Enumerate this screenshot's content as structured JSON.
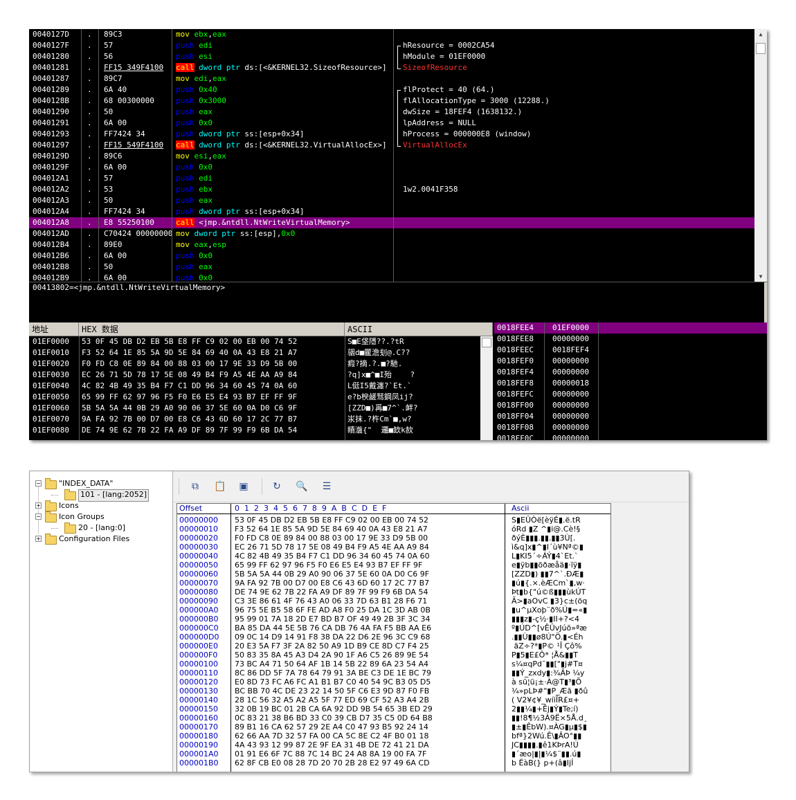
{
  "disasm": {
    "rows": [
      {
        "addr": "0040127D",
        "mark": ".",
        "hex": "89C3",
        "parts": [
          [
            "kw-mov",
            "mov "
          ],
          [
            "grn",
            "ebx"
          ],
          [
            "op",
            ","
          ],
          [
            "grn",
            "eax"
          ]
        ]
      },
      {
        "addr": "0040127F",
        "mark": ".",
        "hex": "57",
        "parts": [
          [
            "kw-push",
            "push "
          ],
          [
            "grn",
            "edi"
          ]
        ]
      },
      {
        "addr": "00401280",
        "mark": ".",
        "hex": "56",
        "parts": [
          [
            "kw-push",
            "push "
          ],
          [
            "grn",
            "esi"
          ]
        ]
      },
      {
        "addr": "00401281",
        "mark": ".",
        "hex": "FF15 349F4100",
        "hexul": true,
        "parts": [
          [
            "kw-call",
            "call"
          ],
          [
            "op",
            " "
          ],
          [
            "cyan",
            "dword ptr "
          ],
          [
            "op",
            "ds:[<&KERNEL32.SizeofResource>]"
          ]
        ]
      },
      {
        "addr": "00401287",
        "mark": ".",
        "hex": "89C7",
        "parts": [
          [
            "kw-mov",
            "mov "
          ],
          [
            "grn",
            "edi"
          ],
          [
            "op",
            ","
          ],
          [
            "grn",
            "eax"
          ]
        ]
      },
      {
        "addr": "00401289",
        "mark": ".",
        "hex": "6A 40",
        "parts": [
          [
            "kw-push",
            "push "
          ],
          [
            "grn",
            "0x40"
          ]
        ]
      },
      {
        "addr": "0040128B",
        "mark": ".",
        "hex": "68 00300000",
        "parts": [
          [
            "kw-push",
            "push "
          ],
          [
            "grn",
            "0x3000"
          ]
        ]
      },
      {
        "addr": "00401290",
        "mark": ".",
        "hex": "50",
        "parts": [
          [
            "kw-push",
            "push "
          ],
          [
            "grn",
            "eax"
          ]
        ]
      },
      {
        "addr": "00401291",
        "mark": ".",
        "hex": "6A 00",
        "parts": [
          [
            "kw-push",
            "push "
          ],
          [
            "grn",
            "0x0"
          ]
        ]
      },
      {
        "addr": "00401293",
        "mark": ".",
        "hex": "FF7424 34",
        "parts": [
          [
            "kw-push",
            "push "
          ],
          [
            "cyan",
            "dword ptr "
          ],
          [
            "op",
            "ss:[esp+0x34]"
          ]
        ]
      },
      {
        "addr": "00401297",
        "mark": ".",
        "hex": "FF15 549F4100",
        "hexul": true,
        "parts": [
          [
            "kw-call",
            "call"
          ],
          [
            "op",
            " "
          ],
          [
            "cyan",
            "dword ptr "
          ],
          [
            "op",
            "ds:[<&KERNEL32.VirtualAllocEx>]"
          ]
        ]
      },
      {
        "addr": "0040129D",
        "mark": ".",
        "hex": "89C6",
        "parts": [
          [
            "kw-mov",
            "mov "
          ],
          [
            "grn",
            "esi"
          ],
          [
            "op",
            ","
          ],
          [
            "grn",
            "eax"
          ]
        ]
      },
      {
        "addr": "0040129F",
        "mark": ".",
        "hex": "6A 00",
        "parts": [
          [
            "kw-push",
            "push "
          ],
          [
            "grn",
            "0x0"
          ]
        ]
      },
      {
        "addr": "004012A1",
        "mark": ".",
        "hex": "57",
        "parts": [
          [
            "kw-push",
            "push "
          ],
          [
            "grn",
            "edi"
          ]
        ]
      },
      {
        "addr": "004012A2",
        "mark": ".",
        "hex": "53",
        "parts": [
          [
            "kw-push",
            "push "
          ],
          [
            "grn",
            "ebx"
          ]
        ]
      },
      {
        "addr": "004012A3",
        "mark": ".",
        "hex": "50",
        "parts": [
          [
            "kw-push",
            "push "
          ],
          [
            "grn",
            "eax"
          ]
        ]
      },
      {
        "addr": "004012A4",
        "mark": ".",
        "hex": "FF7424 34",
        "parts": [
          [
            "kw-push",
            "push "
          ],
          [
            "cyan",
            "dword ptr "
          ],
          [
            "op",
            "ss:[esp+0x34]"
          ]
        ]
      },
      {
        "addr": "004012A8",
        "mark": ".",
        "hex": "E8 55250100",
        "sel": true,
        "parts": [
          [
            "kw-call",
            "call"
          ],
          [
            "op",
            " <jmp.&ntdll.NtWriteVirtualMemory>"
          ]
        ]
      },
      {
        "addr": "004012AD",
        "mark": ".",
        "hex": "C70424 00000000",
        "parts": [
          [
            "kw-mov",
            "mov "
          ],
          [
            "cyan",
            "dword ptr "
          ],
          [
            "op",
            "ss:[esp],"
          ],
          [
            "grn",
            "0x0"
          ]
        ]
      },
      {
        "addr": "004012B4",
        "mark": ".",
        "hex": "89E0",
        "parts": [
          [
            "kw-mov",
            "mov "
          ],
          [
            "grn",
            "eax"
          ],
          [
            "op",
            ","
          ],
          [
            "grn",
            "esp"
          ]
        ]
      },
      {
        "addr": "004012B6",
        "mark": ".",
        "hex": "6A 00",
        "parts": [
          [
            "kw-push",
            "push "
          ],
          [
            "grn",
            "0x0"
          ]
        ]
      },
      {
        "addr": "004012B8",
        "mark": ".",
        "hex": "50",
        "parts": [
          [
            "kw-push",
            "push "
          ],
          [
            "grn",
            "eax"
          ]
        ]
      },
      {
        "addr": "004012B9",
        "mark": ".",
        "hex": "6A 00",
        "parts": [
          [
            "kw-push",
            "push "
          ],
          [
            "grn",
            "0x0"
          ]
        ]
      }
    ],
    "comments": [
      {
        "row": 1,
        "text": "hResource = 0002CA54"
      },
      {
        "row": 2,
        "text": "hModule = 01EF0000"
      },
      {
        "row": 3,
        "text": "SizeofResource",
        "red": true
      },
      {
        "row": 5,
        "text": "flProtect = 40 (64.)"
      },
      {
        "row": 6,
        "text": "flAllocationType = 3000 (12288.)"
      },
      {
        "row": 7,
        "text": "dwSize = 18FEF4 (1638132.)"
      },
      {
        "row": 8,
        "text": "lpAddress = NULL"
      },
      {
        "row": 9,
        "text": "hProcess = 000000E8 (window)"
      },
      {
        "row": 10,
        "text": "VirtualAllocEx",
        "red": true
      },
      {
        "row": 14,
        "text": "1w2.0041F358"
      }
    ],
    "info": "00413802=<jmp.&ntdll.NtWriteVirtualMemory>"
  },
  "dump": {
    "headers": {
      "address": "地址",
      "hex": "HEX 数据",
      "ascii": "ASCII"
    },
    "rows": [
      {
        "addr": "01EF0000",
        "hex": "53 0F 45 DB D2 EB 5B E8 FF C9 02 00 EB 00 74 52",
        "ascii": "S■E垡隱??.?tR"
      },
      {
        "addr": "01EF0010",
        "hex": "F3 52 64 1E 85 5A 9D 5E 84 69 40 0A 43 E8 21 A7",
        "ascii": "骃d■匷澹刬@.C??"
      },
      {
        "addr": "01EF0020",
        "hex": "F0 FD C8 0E 89 84 00 88 03 00 17 9E 33 D9 5B 00",
        "ascii": "瘕?摘.?.■?馳."
      },
      {
        "addr": "01EF0030",
        "hex": "EC 26 71 5D 78 17 5E 08 49 B4 F9 A5 4E AA A9 84",
        "ascii": "?q]x■^■I殆    ?"
      },
      {
        "addr": "01EF0040",
        "hex": "4C 82 4B 49 35 B4 F7 C1 DD 96 34 60 45 74 0A 60",
        "ascii": "L侹I5戴瀍?`Et.`"
      },
      {
        "addr": "01EF0050",
        "hex": "65 99 FF 62 97 96 F5 F0 E6 E5 E4 93 B7 EF FF 9F",
        "ascii": "e?b楰鹾驽鋼凤ij?"
      },
      {
        "addr": "01EF0060",
        "hex": "5B 5A 5A 44 0B 29 A0 90 06 37 5E 60 0A D0 C6 9F",
        "ascii": "[ZZD■)爯■7^`.衅?"
      },
      {
        "addr": "01EF0070",
        "hex": "9A FA 92 7B 00 D7 00 E8 C6 43 6D 60 17 2C 77 B7",
        "ascii": "汖抹.?杵Cm`■,w?"
      },
      {
        "addr": "01EF0080",
        "hex": "DE 74 9E 62 7B 22 FA A9 DF 89 7F 99 F9 6B DA 54",
        "ascii": "瞔瀊{\"  邏■欫k赥"
      }
    ]
  },
  "stack": {
    "rows": [
      {
        "addr": "0018FEE4",
        "val": "01EF0000",
        "sel": true
      },
      {
        "addr": "0018FEE8",
        "val": "00000000"
      },
      {
        "addr": "0018FEEC",
        "val": "0018FEF4"
      },
      {
        "addr": "0018FEF0",
        "val": "00000000"
      },
      {
        "addr": "0018FEF4",
        "val": "00000000"
      },
      {
        "addr": "0018FEF8",
        "val": "00000018"
      },
      {
        "addr": "0018FEFC",
        "val": "00000000"
      },
      {
        "addr": "0018FF00",
        "val": "00000000"
      },
      {
        "addr": "0018FF04",
        "val": "00000000"
      },
      {
        "addr": "0018FF08",
        "val": "00000000"
      },
      {
        "addr": "0018FF0C",
        "val": "00000000"
      }
    ]
  },
  "tree": {
    "items": [
      {
        "label": "\"INDEX_DATA\"",
        "level": 0,
        "box": "−"
      },
      {
        "label": "101 - [lang:2052]",
        "level": 1,
        "selected": true
      },
      {
        "label": "Icons",
        "level": 0,
        "box": "+"
      },
      {
        "label": "Icon Groups",
        "level": 0,
        "box": "−"
      },
      {
        "label": "20 - [lang:0]",
        "level": 1
      },
      {
        "label": "Configuration Files",
        "level": 0,
        "box": "+"
      }
    ]
  },
  "toolbar": {
    "icons": [
      "copy-icon",
      "paste-icon",
      "window-icon",
      "redo-icon",
      "search-icon",
      "table-icon"
    ],
    "glyphs": [
      "⧉",
      "📋",
      "▣",
      "↻",
      "🔍",
      "☰"
    ]
  },
  "hexeditor": {
    "header": {
      "offset": "Offset",
      "cols": "0  1  2  3  4  5  6  7  8  9  A  B  C  D  E  F",
      "ascii": "Ascii"
    },
    "rows": [
      {
        "off": "00000000",
        "hex": "53 0F 45 DB D2 EB 5B E8 FF C9 02 00 EB 00 74 52",
        "asc": "S▮EÛÒë[èÿÉ▮.ë.tR"
      },
      {
        "off": "00000010",
        "hex": "F3 52 64 1E 85 5A 9D 5E 84 69 40 0A 43 E8 21 A7",
        "asc": "óRd ▮Z ^▮i@.Cè!§"
      },
      {
        "off": "00000020",
        "hex": "F0 FD C8 0E 89 84 00 88 03 00 17 9E 33 D9 5B 00",
        "asc": "ðýÈ▮▮▮.▮▮.▮▮3Ù[."
      },
      {
        "off": "00000030",
        "hex": "EC 26 71 5D 78 17 5E 08 49 B4 F9 A5 4E AA A9 84",
        "asc": "ì&q]x▮^▮I´ù¥Nª©▮"
      },
      {
        "off": "00000040",
        "hex": "4C 82 4B 49 35 B4 F7 C1 DD 96 34 60 45 74 0A 60",
        "asc": "L▮KI5´÷ÁÝ▮4`Et.`"
      },
      {
        "off": "00000050",
        "hex": "65 99 FF 62 97 96 F5 F0 E6 E5 E4 93 B7 EF FF 9F",
        "asc": "e▮ÿb▮▮õðæåä▮·ïÿ▮"
      },
      {
        "off": "00000060",
        "hex": "5B 5A 5A 44 0B 29 A0 90 06 37 5E 60 0A D0 C6 9F",
        "asc": "[ZZD▮) ▮▮7^`.ÐÆ▮"
      },
      {
        "off": "00000070",
        "hex": "9A FA 92 7B 00 D7 00 E8 C6 43 6D 60 17 2C 77 B7",
        "asc": "▮ú▮{.×.èÆCm`▮,w·"
      },
      {
        "off": "00000080",
        "hex": "DE 74 9E 62 7B 22 FA A9 DF 89 7F 99 F9 6B DA 54",
        "asc": "Þt▮b{\"ú©ß▮▮▮ùkÚT"
      },
      {
        "off": "00000090",
        "hex": "C3 3E 86 61 4F 76 43 A0 06 33 7D 63 B1 28 F6 71",
        "asc": "Ã>▮aOvC ▮3}c±(öq"
      },
      {
        "off": "000000A0",
        "hex": "96 75 5E B5 58 6F FE AD A8 F0 25 DA 1C 3D AB 0B",
        "asc": "▮u^µXoþ­¨ð%Ú▮=«▮"
      },
      {
        "off": "000000B0",
        "hex": "95 99 01 7A 18 2D E7 BD B7 OF 49 49 2B 3F 3C 34",
        "asc": "▮▮▮z▮-ç½·▮II+?<4"
      },
      {
        "off": "000000C0",
        "hex": "BA 85 DA 44 5E 5B 76 CA DB 76 4A FA F5 BB AA E6",
        "asc": "º▮ÚD^[vÊÛvJúõ»ªæ"
      },
      {
        "off": "000000D0",
        "hex": "09 0C 14 D9 14 91 F8 38 DA 22 D6 2E 96 3C C9 68",
        "asc": ".▮▮Ù▮▮ø8Ú\"Ö.▮<Éh"
      },
      {
        "off": "000000E0",
        "hex": "20 E3 5A F7 3F 2A 82 50 A9 1D B9 CE 8D C7 F4 25",
        "asc": " ãZ÷?*▮P© ¹Î Çô%"
      },
      {
        "off": "000000F0",
        "hex": "50 83 35 8A 45 A3 D4 2A 90 1F A6 C5 26 89 9E 54",
        "asc": "P▮5▮E£Ô* ¦Å&▮▮T"
      },
      {
        "off": "00000100",
        "hex": "73 BC A4 71 50 64 AF 1B 14 5B 22 89 6A 23 54 A4",
        "asc": "s¼¤qPd¯▮▮[\"▮j#T¤"
      },
      {
        "off": "00000110",
        "hex": "8C 86 DD 5F 7A 78 64 79 91 3A BE C3 DE 1E BC 79",
        "asc": "▮▮Ý_zxdy▮:¾ÃÞ ¼y"
      },
      {
        "off": "00000120",
        "hex": "E0 8D 73 FC A6 FC A1 B1 B7 C0 40 54 9C B3 05 D5",
        "asc": "à sü¦ü¡±·À@T▮³▮Õ"
      },
      {
        "off": "00000130",
        "hex": "BC BB 70 4C DE 23 22 14 50 5F C6 E3 9D 87 F0 FB",
        "asc": "¼»pLÞ#\"▮P_Æã ▮ðû"
      },
      {
        "off": "00000140",
        "hex": "28 1C 56 32 A5 A2 A5 5F 77 ED 69 CF 52 A3 A4 2B",
        "asc": "( V2¥¢¥_wíiÏR£¤+"
      },
      {
        "off": "00000150",
        "hex": "32 0B 19 BC 01 2B CA 6A 92 DD 9B 54 65 3B ED 29",
        "asc": "2▮▮¼▮+Êj▮Ý▮Te;í)"
      },
      {
        "off": "00000160",
        "hex": "0C 83 21 38 B6 BD 33 C0 39 CB D7 35 C5 0D 64 B8",
        "asc": "▮▮!8¶½3À9Ë×5Å.d¸"
      },
      {
        "off": "00000170",
        "hex": "89 B1 16 CA 62 57 29 2E A4 C0 47 93 B5 92 24 14",
        "asc": "▮±▮ÊbW).¤ÀG▮µ▮$▮"
      },
      {
        "off": "00000180",
        "hex": "62 66 AA 7D 32 57 FA 00 CA 5C 8E C2 4F B0 01 18",
        "asc": "bfª}2Wú.Ê\\▮ÂO°▮▮"
      },
      {
        "off": "00000190",
        "hex": "4A 43 93 12 99 87 2E 9F EA 31 4B DE 72 41 21 DA",
        "asc": "JC▮▮▮▮.▮ê1KÞrA!Ú"
      },
      {
        "off": "000001A0",
        "hex": "01 91 E6 6F 7C 88 7C 14 BC 24 A8 8A 19 00 FA 7F",
        "asc": "▮´æo|▮|▮¼$¨▮▮.ú▮"
      },
      {
        "off": "000001B0",
        "hex": "62 8F CB E0 08 28 7D 20 70 2B 28 E2 97 49 6A CD",
        "asc": "b ËàB(} p+(â▮IjÍ"
      }
    ]
  },
  "colors": {
    "debugger_bg": "#000000",
    "selection": "#800080",
    "push": "#0000ff",
    "mov": "#ffff00",
    "call_bg": "#ff0000",
    "hex_offset": "#0000c0"
  }
}
